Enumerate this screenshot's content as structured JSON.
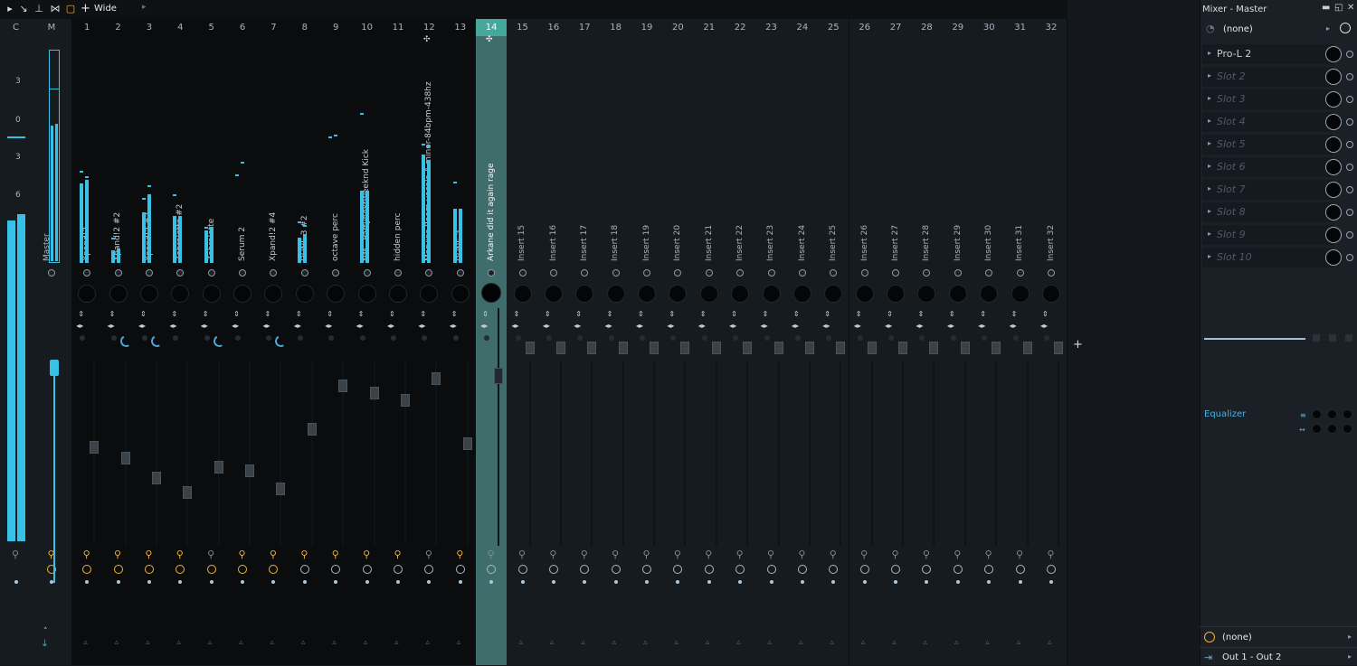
{
  "toolbar": {
    "wide_label": "Wide"
  },
  "strips": [
    {
      "num": "C",
      "name": "",
      "style": "dark"
    },
    {
      "num": "M",
      "name": "Master",
      "style": "dark"
    },
    {
      "num": "1",
      "name": "Xpand!2",
      "style": "black"
    },
    {
      "num": "2",
      "name": "Xpand!2 #2",
      "style": "black"
    },
    {
      "num": "3",
      "name": "Xpand!2 #3",
      "style": "black"
    },
    {
      "num": "4",
      "name": "Zebralette #2",
      "style": "black"
    },
    {
      "num": "5",
      "name": "Zebralette",
      "style": "black"
    },
    {
      "num": "6",
      "name": "Serum 2",
      "style": "black"
    },
    {
      "num": "7",
      "name": "Xpand!2 #4",
      "style": "black"
    },
    {
      "num": "8",
      "name": "DUNE 3 #2",
      "style": "black"
    },
    {
      "num": "9",
      "name": "octave perc",
      "style": "black"
    },
    {
      "num": "10",
      "name": "NM - PartynextWeeknd Kick",
      "style": "black"
    },
    {
      "num": "11",
      "name": "hidden perc",
      "style": "black"
    },
    {
      "num": "12",
      "name": "Marvins Room-vocals-A minor-84bpm-438hz",
      "style": "black"
    },
    {
      "num": "13",
      "name": "DUNE 3",
      "style": "black"
    },
    {
      "num": "14",
      "name": "Arkane did it again rage",
      "style": "selected"
    },
    {
      "num": "15",
      "name": "Insert 15",
      "style": "dark"
    },
    {
      "num": "16",
      "name": "Insert 16",
      "style": "dark"
    },
    {
      "num": "17",
      "name": "Insert 17",
      "style": "dark"
    },
    {
      "num": "18",
      "name": "Insert 18",
      "style": "dark"
    },
    {
      "num": "19",
      "name": "Insert 19",
      "style": "dark"
    },
    {
      "num": "20",
      "name": "Insert 20",
      "style": "dark"
    },
    {
      "num": "21",
      "name": "Insert 21",
      "style": "dark"
    },
    {
      "num": "22",
      "name": "Insert 22",
      "style": "dark"
    },
    {
      "num": "23",
      "name": "Insert 23",
      "style": "dark"
    },
    {
      "num": "24",
      "name": "Insert 24",
      "style": "dark"
    },
    {
      "num": "25",
      "name": "Insert 25",
      "style": "dark"
    },
    {
      "num": "26",
      "name": "Insert 26",
      "style": "dark"
    },
    {
      "num": "27",
      "name": "Insert 27",
      "style": "dark"
    },
    {
      "num": "28",
      "name": "Insert 28",
      "style": "dark"
    },
    {
      "num": "29",
      "name": "Insert 29",
      "style": "dark"
    },
    {
      "num": "30",
      "name": "Insert 30",
      "style": "dark"
    },
    {
      "num": "31",
      "name": "Insert 31",
      "style": "dark"
    },
    {
      "num": "32",
      "name": "Insert 32",
      "style": "dark"
    }
  ],
  "scale_labels": [
    "3",
    "0",
    "3",
    "6"
  ],
  "right_panel": {
    "title": "Mixer - Master",
    "input": "(none)",
    "slots": [
      "Pro-L 2",
      "Slot 2",
      "Slot 3",
      "Slot 4",
      "Slot 5",
      "Slot 6",
      "Slot 7",
      "Slot 8",
      "Slot 9",
      "Slot 10"
    ],
    "equalizer_label": "Equalizer",
    "output_none": "(none)",
    "output_route": "Out 1 - Out 2"
  },
  "colors": {
    "accent": "#39c0e6",
    "selected": "#44a89b",
    "mute_on": "#f2b233"
  }
}
